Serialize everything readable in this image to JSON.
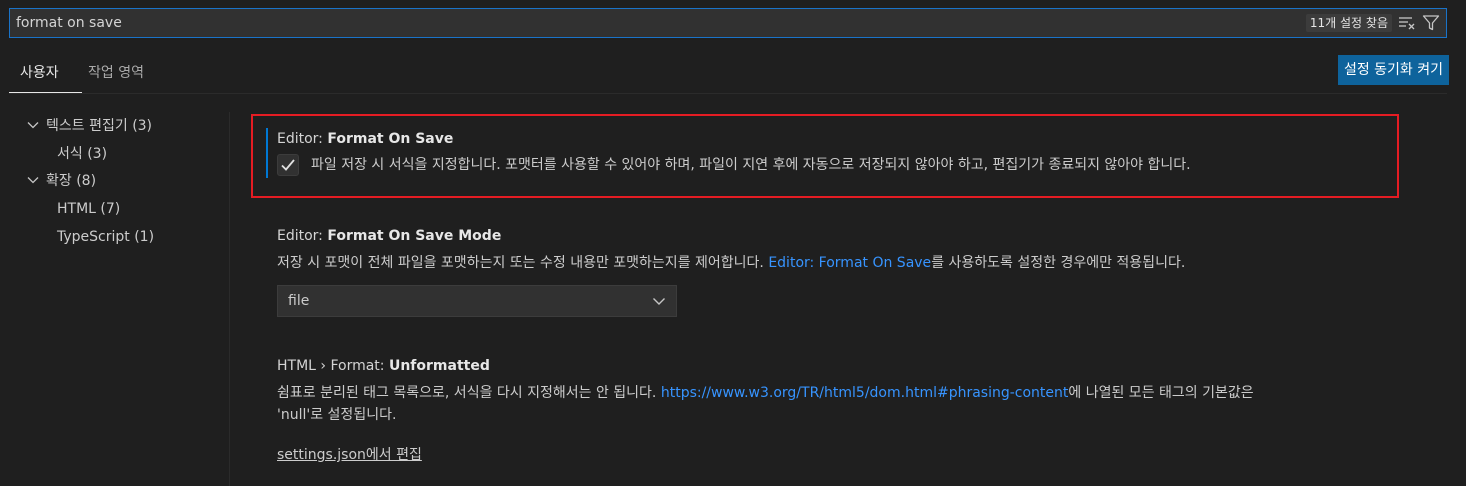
{
  "search": {
    "value": "format on save",
    "result_count": "11개 설정 찾음",
    "clear_icon": "clear-filter-icon",
    "filter_icon": "filter-icon"
  },
  "tabs": [
    {
      "label": "사용자",
      "active": true
    },
    {
      "label": "작업 영역",
      "active": false
    }
  ],
  "sync_button": "설정 동기화 켜기",
  "toc": [
    {
      "label": "텍스트 편집기",
      "count": "(3)",
      "expanded": true,
      "level": 0
    },
    {
      "label": "서식",
      "count": "(3)",
      "level": 1
    },
    {
      "label": "확장",
      "count": "(8)",
      "expanded": true,
      "level": 0
    },
    {
      "label": "HTML",
      "count": "(7)",
      "level": 1
    },
    {
      "label": "TypeScript",
      "count": "(1)",
      "level": 1
    }
  ],
  "settings": {
    "format_on_save": {
      "category": "Editor: ",
      "name": "Format On Save",
      "checked": true,
      "description": "파일 저장 시 서식을 지정합니다. 포맷터를 사용할 수 있어야 하며, 파일이 지연 후에 자동으로 저장되지 않아야 하고, 편집기가 종료되지 않아야 합니다."
    },
    "format_on_save_mode": {
      "category": "Editor: ",
      "name": "Format On Save Mode",
      "description_before": "저장 시 포맷이 전체 파일을 포맷하는지 또는 수정 내용만 포맷하는지를 제어합니다. ",
      "description_link": "Editor: Format On Save",
      "description_after": "를 사용하도록 설정한 경우에만 적용됩니다.",
      "value": "file"
    },
    "html_unformatted": {
      "category": "HTML › Format: ",
      "name": "Unformatted",
      "description_before": "쉼표로 분리된 태그 목록으로, 서식을 다시 지정해서는 안 됩니다. ",
      "description_link": "https://www.w3.org/TR/html5/dom.html#phrasing-content",
      "description_after_line1": "에 나열된 모든 태그의 기본값은",
      "description_line2": "'null'로 설정됩니다.",
      "edit_link": "settings.json에서 편집"
    }
  },
  "colors": {
    "accent": "#0078d4",
    "link": "#3794ff",
    "highlight": "#e51c23",
    "button": "#0e639c"
  }
}
